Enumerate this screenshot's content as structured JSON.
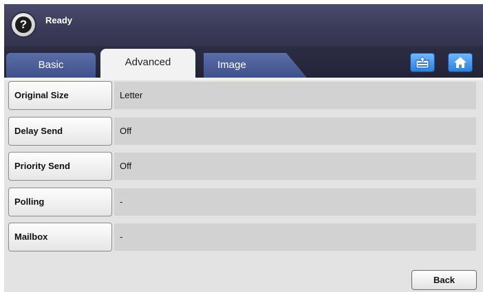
{
  "header": {
    "help_glyph": "?",
    "status": "Ready"
  },
  "tabs": [
    {
      "label": "Basic",
      "selected": false
    },
    {
      "label": "Advanced",
      "selected": true
    },
    {
      "label": "Image",
      "selected": false
    }
  ],
  "toolbar": {
    "job_status_icon": "job-status-icon",
    "home_icon": "home-icon"
  },
  "settings": [
    {
      "label": "Original Size",
      "value": "Letter"
    },
    {
      "label": "Delay Send",
      "value": "Off"
    },
    {
      "label": "Priority Send",
      "value": "Off"
    },
    {
      "label": "Polling",
      "value": "-"
    },
    {
      "label": "Mailbox",
      "value": "-"
    }
  ],
  "footer": {
    "back_label": "Back"
  },
  "colors": {
    "header": "#3a3a58",
    "tab_inactive": "#4a5d98",
    "icon_button": "#2d7fdc",
    "value_field": "#d2d2d2"
  }
}
